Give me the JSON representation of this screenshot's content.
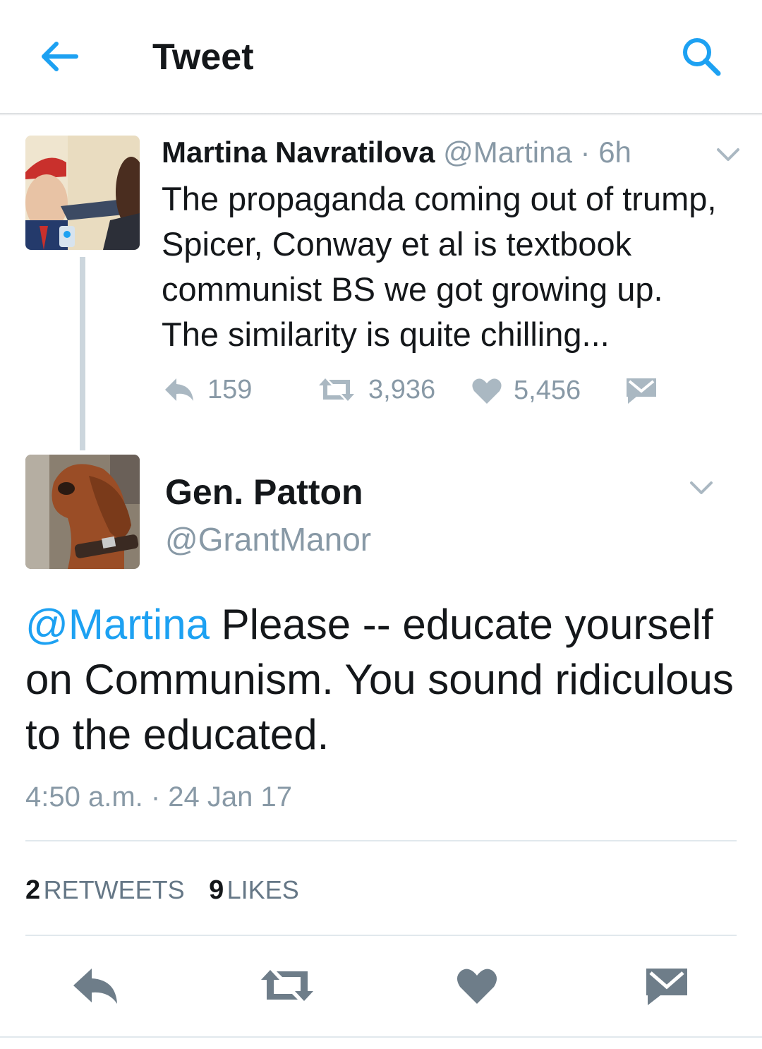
{
  "header": {
    "title": "Tweet",
    "back_icon": "arrow-left-icon",
    "search_icon": "search-icon",
    "accent_color": "#1da1f2"
  },
  "parent_tweet": {
    "author_name": "Martina Navratilova",
    "handle": "@Martina",
    "separator": "·",
    "time": "6h",
    "text_lines": [
      "The propaganda coming out of trump,",
      "Spicer, Conway et al is textbook",
      "communist BS we got growing up.",
      "The similarity is quite chilling..."
    ],
    "replies": "159",
    "retweets": "3,936",
    "likes": "5,456"
  },
  "main_tweet": {
    "author_name": "Gen. Patton",
    "handle": "@GrantManor",
    "mention": "@Martina",
    "text_first": " Please -- educate yourself",
    "text_line2": "on Communism. You sound ridiculous",
    "text_line3": "to the educated.",
    "timestamp": "4:50 a.m. · 24 Jan 17",
    "retweet_count": "2",
    "retweet_label": "RETWEETS",
    "like_count": "9",
    "like_label": "LIKES"
  },
  "action_bar": {
    "icons": [
      "reply-icon",
      "retweet-icon",
      "heart-icon",
      "message-icon"
    ]
  },
  "colors": {
    "text": "#14171a",
    "muted": "#8899a6",
    "accent": "#1da1f2",
    "icon_dark": "#6e7d89"
  }
}
